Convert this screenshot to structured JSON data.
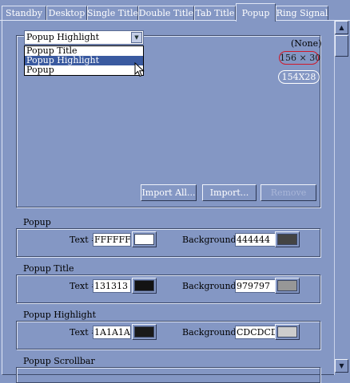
{
  "tabs": [
    {
      "label": "Standby",
      "active": false
    },
    {
      "label": "Desktop",
      "active": false
    },
    {
      "label": "Single Title",
      "active": false
    },
    {
      "label": "Double Title",
      "active": false
    },
    {
      "label": "Tab Title",
      "active": false
    },
    {
      "label": "Popup",
      "active": true
    },
    {
      "label": "Ring Signal",
      "active": false
    }
  ],
  "preview": {
    "combo_value": "Popup Highlight",
    "dropdown_options": [
      "Popup Title",
      "Popup Highlight",
      "Popup"
    ],
    "selected_option": "Popup Highlight",
    "none_label": "(None)",
    "size_selected": "156 × 30",
    "size_other": "154X28",
    "import_all_label": "Import All...",
    "import_label": "Import...",
    "remove_label": "Remove"
  },
  "sections": [
    {
      "title": "Popup",
      "text_label": "Text #",
      "text_value": "FFFFFF",
      "text_color": "#FFFFFF",
      "bg_label": "Background #",
      "bg_value": "444444",
      "bg_color": "#444444"
    },
    {
      "title": "Popup Title",
      "text_label": "Text #",
      "text_value": "131313",
      "text_color": "#131313",
      "bg_label": "Background #",
      "bg_value": "979797",
      "bg_color": "#979797"
    },
    {
      "title": "Popup Highlight",
      "text_label": "Text #",
      "text_value": "1A1A1A",
      "text_color": "#1A1A1A",
      "bg_label": "Background #",
      "bg_value": "CDCDCD",
      "bg_color": "#CDCDCD"
    },
    {
      "title": "Popup Scrollbar"
    }
  ],
  "scrollbar": {
    "up_icon": "scroll-up-arrow-icon",
    "down_icon": "scroll-down-arrow-icon"
  },
  "colors": {
    "page_bg": "#8497c4",
    "highlight": "#3a5aa0",
    "selected_size_ring": "#d0182a"
  }
}
